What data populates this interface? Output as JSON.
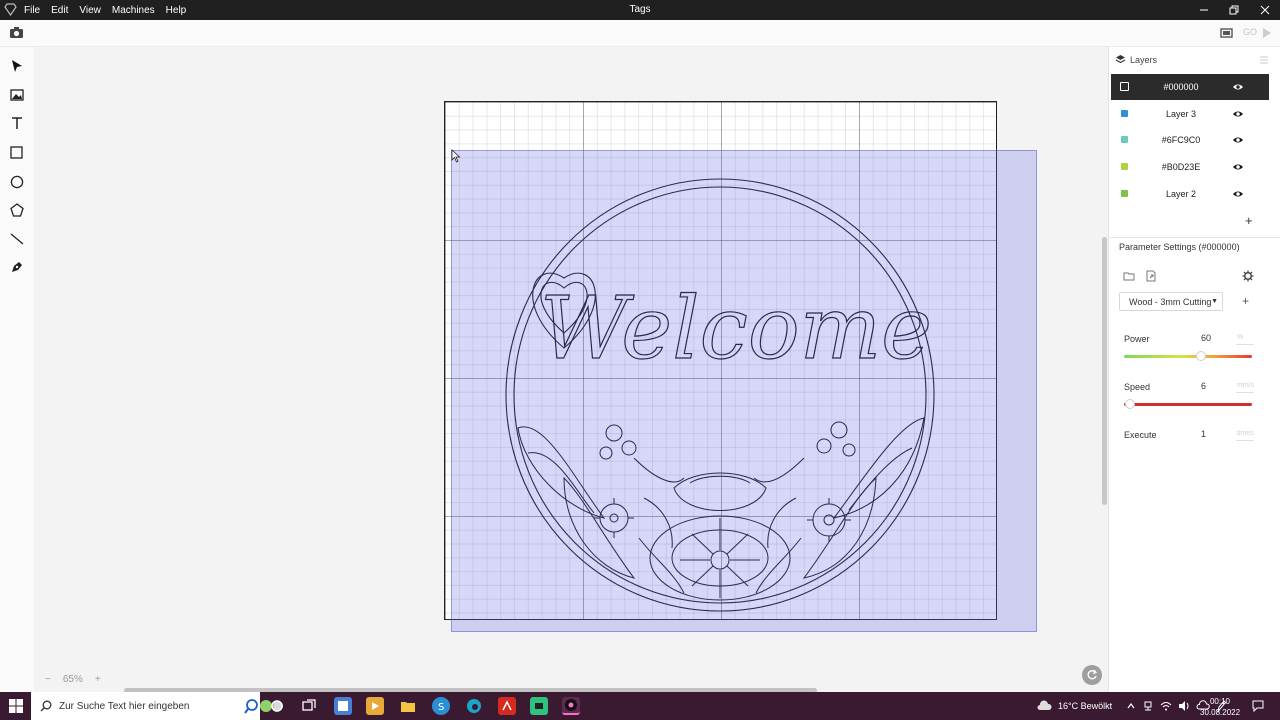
{
  "app": {
    "window_title": "Tags",
    "menu": [
      "File",
      "Edit",
      "View",
      "Machines",
      "Help"
    ],
    "go_label": "GO"
  },
  "canvas": {
    "zoom_minus": "−",
    "zoom_level": "65%",
    "zoom_plus": "+",
    "design_text": "Welcome"
  },
  "layers": {
    "title": "Layers",
    "items": [
      {
        "name": "#000000",
        "color": "#000000",
        "active": true
      },
      {
        "name": "Layer 3",
        "color": "#2f8fd8"
      },
      {
        "name": "#6FC9C0",
        "color": "#6fc9c0"
      },
      {
        "name": "#B0D23E",
        "color": "#b0d23e"
      },
      {
        "name": "Layer 2",
        "color": "#7dc34a"
      }
    ],
    "add": "+"
  },
  "params": {
    "title": "Parameter Settings (#000000)",
    "preset": "Wood - 3mm Cutting",
    "preset_add": "+",
    "power_label": "Power",
    "power_value": "60",
    "power_unit": "%",
    "power_fraction": 0.6,
    "speed_label": "Speed",
    "speed_value": "6",
    "speed_unit": "mm/s",
    "execute_label": "Execute",
    "execute_value": "1",
    "execute_unit": "times"
  },
  "taskbar": {
    "search_placeholder": "Zur Suche Text hier eingeben",
    "weather": "16°C  Bewölkt",
    "time": "00:10",
    "date": "30.08.2022"
  },
  "colors": {
    "accent": "#2b2b2b",
    "selection": "#6363e1",
    "taskbar": "#3a1a31"
  }
}
